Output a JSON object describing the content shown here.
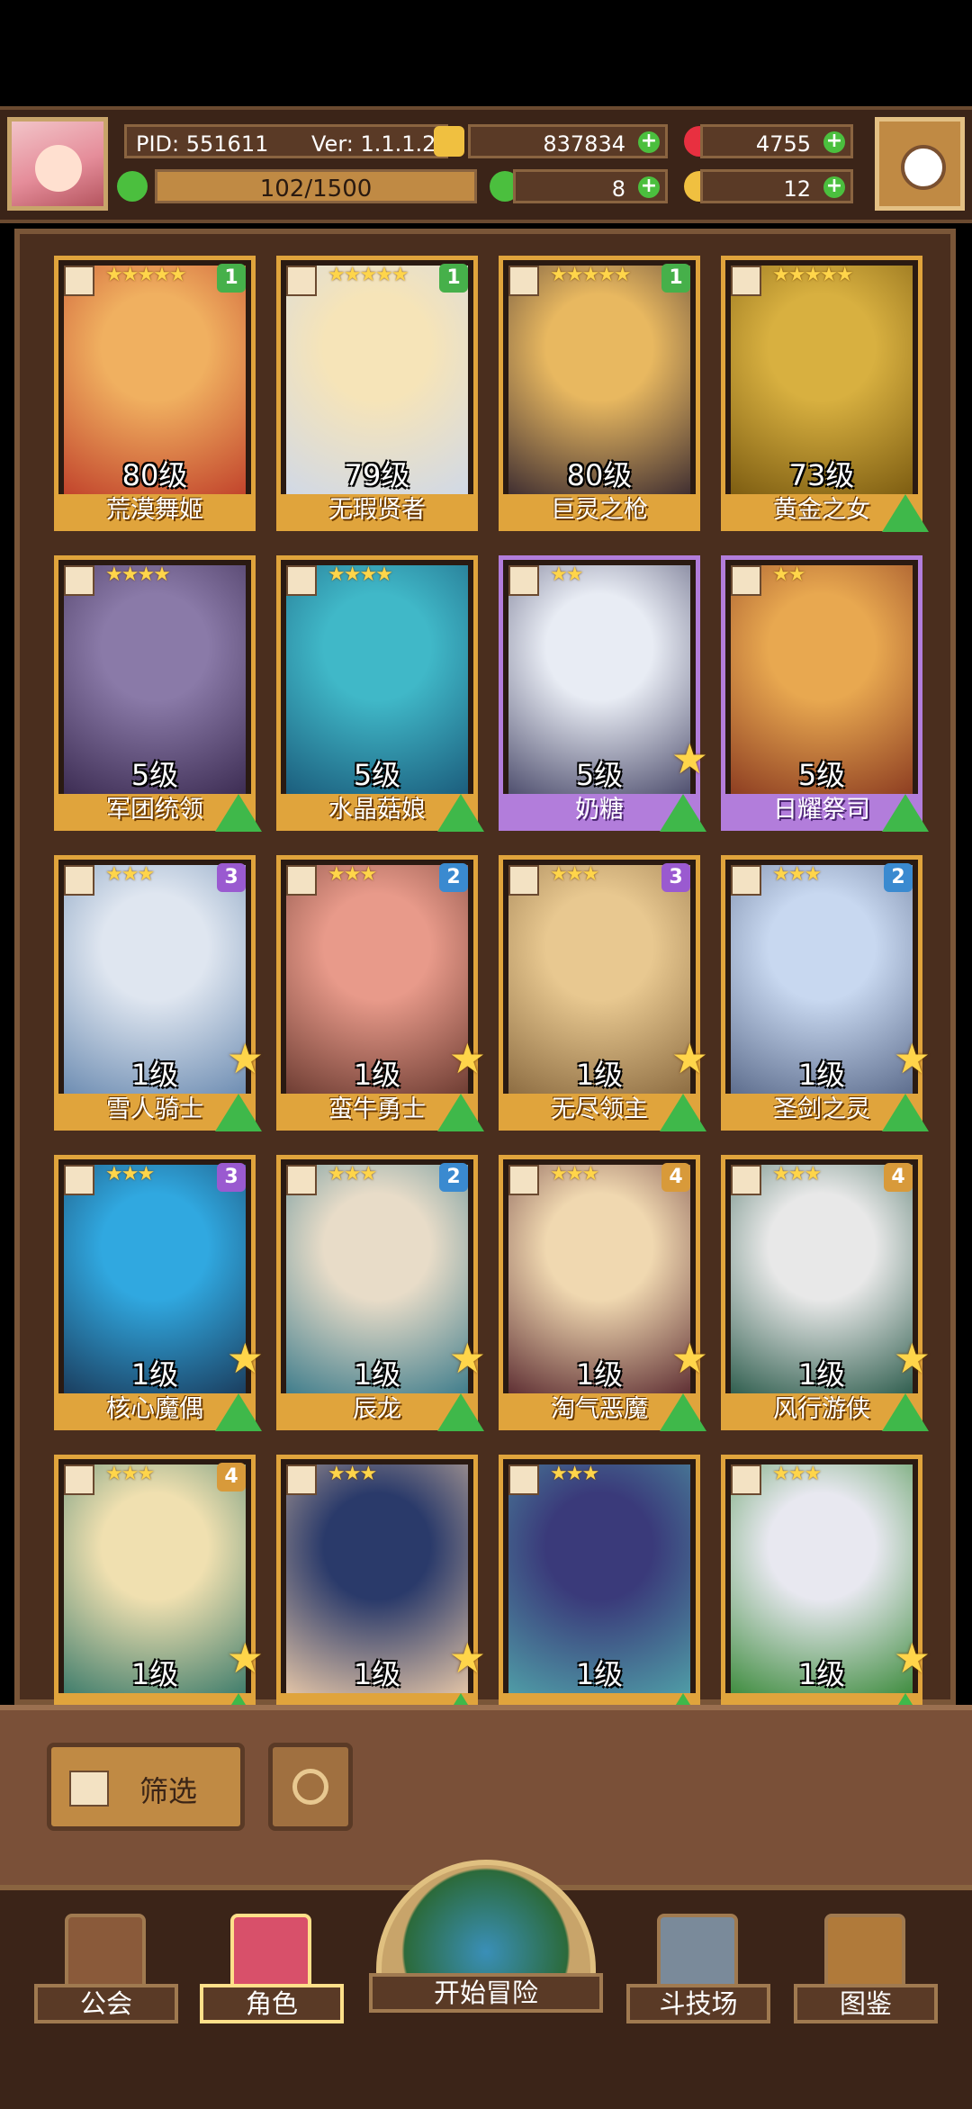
{
  "player": {
    "pid_label": "PID: 551611",
    "version": "Ver: 1.1.1.2",
    "gold": "837834",
    "gems": "4755",
    "energy": "102/1500",
    "clover": "8",
    "bread": "12"
  },
  "colors": {
    "frame_gold": "#e0a43c",
    "frame_purple": "#b27ddb",
    "plus_green": "#4bbf3e",
    "board_bg": "#4a2e1e"
  },
  "cards": [
    {
      "name": "荒漠舞姬",
      "level": "80级",
      "stars": "★★★★★",
      "badge": "1",
      "badge_color": "#46b04a",
      "frame": "gold",
      "art": [
        "#f0b060",
        "#c0402a"
      ],
      "upgrade": false,
      "star": false
    },
    {
      "name": "无瑕贤者",
      "level": "79级",
      "stars": "★★★★★",
      "badge": "1",
      "badge_color": "#46b04a",
      "frame": "gold",
      "art": [
        "#f6e4b8",
        "#cfd8e8"
      ],
      "upgrade": false,
      "star": false
    },
    {
      "name": "巨灵之枪",
      "level": "80级",
      "stars": "★★★★★",
      "badge": "1",
      "badge_color": "#46b04a",
      "frame": "gold",
      "art": [
        "#e8b860",
        "#3a2a30"
      ],
      "upgrade": false,
      "star": false
    },
    {
      "name": "黄金之女",
      "level": "73级",
      "stars": "★★★★★",
      "badge": "",
      "badge_color": "",
      "frame": "gold",
      "art": [
        "#d8b040",
        "#7a5a10"
      ],
      "upgrade": true,
      "star": false
    },
    {
      "name": "军团统领",
      "level": "5级",
      "stars": "★★★★",
      "badge": "",
      "badge_color": "",
      "frame": "gold",
      "art": [
        "#8a7aa8",
        "#3a2a50"
      ],
      "upgrade": true,
      "star": false
    },
    {
      "name": "水晶菇娘",
      "level": "5级",
      "stars": "★★★★",
      "badge": "",
      "badge_color": "",
      "frame": "gold",
      "art": [
        "#40b8c8",
        "#1a5a7a"
      ],
      "upgrade": true,
      "star": false
    },
    {
      "name": "奶糖",
      "level": "5级",
      "stars": "★★",
      "badge": "",
      "badge_color": "",
      "frame": "purple",
      "art": [
        "#e8ecf4",
        "#4a4a6a"
      ],
      "upgrade": true,
      "star": true
    },
    {
      "name": "日耀祭司",
      "level": "5级",
      "stars": "★★",
      "badge": "",
      "badge_color": "",
      "frame": "purple",
      "art": [
        "#e8a850",
        "#8a3a20"
      ],
      "upgrade": true,
      "star": false
    },
    {
      "name": "雪人骑士",
      "level": "1级",
      "stars": "★★★",
      "badge": "3",
      "badge_color": "#9a5ad0",
      "frame": "gold",
      "art": [
        "#dfe6f0",
        "#6a8ab0"
      ],
      "upgrade": true,
      "star": true
    },
    {
      "name": "蛮牛勇士",
      "level": "1级",
      "stars": "★★★",
      "badge": "2",
      "badge_color": "#3a8ad0",
      "frame": "gold",
      "art": [
        "#e89a8a",
        "#6a3a30"
      ],
      "upgrade": true,
      "star": true
    },
    {
      "name": "无尽领主",
      "level": "1级",
      "stars": "★★★",
      "badge": "3",
      "badge_color": "#9a5ad0",
      "frame": "gold",
      "art": [
        "#e8c890",
        "#8a6a40"
      ],
      "upgrade": true,
      "star": true
    },
    {
      "name": "圣剑之灵",
      "level": "1级",
      "stars": "★★★",
      "badge": "2",
      "badge_color": "#3a8ad0",
      "frame": "gold",
      "art": [
        "#c8d8f0",
        "#5a6a8a"
      ],
      "upgrade": true,
      "star": true
    },
    {
      "name": "核心魔偶",
      "level": "1级",
      "stars": "★★★",
      "badge": "3",
      "badge_color": "#9a5ad0",
      "frame": "gold",
      "art": [
        "#30a8e0",
        "#1a3a5a"
      ],
      "upgrade": true,
      "star": true
    },
    {
      "name": "辰龙",
      "level": "1级",
      "stars": "★★★",
      "badge": "2",
      "badge_color": "#3a8ad0",
      "frame": "gold",
      "art": [
        "#e8dcc8",
        "#3a7a8a"
      ],
      "upgrade": true,
      "star": true
    },
    {
      "name": "淘气恶魔",
      "level": "1级",
      "stars": "★★★",
      "badge": "4",
      "badge_color": "#d89a3a",
      "frame": "gold",
      "art": [
        "#f0d8b0",
        "#5a2a30"
      ],
      "upgrade": true,
      "star": true
    },
    {
      "name": "风行游侠",
      "level": "1级",
      "stars": "★★★",
      "badge": "4",
      "badge_color": "#d89a3a",
      "frame": "gold",
      "art": [
        "#e8e8e8",
        "#2a5a4a"
      ],
      "upgrade": true,
      "star": true
    },
    {
      "name": "",
      "level": "1级",
      "stars": "★★★",
      "badge": "4",
      "badge_color": "#d89a3a",
      "frame": "gold",
      "art": [
        "#f0e0b0",
        "#3a7a6a"
      ],
      "upgrade": true,
      "star": true
    },
    {
      "name": "",
      "level": "1级",
      "stars": "★★★",
      "badge": "",
      "badge_color": "",
      "frame": "gold",
      "art": [
        "#2a3a6a",
        "#e8c8a8"
      ],
      "upgrade": true,
      "star": true
    },
    {
      "name": "",
      "level": "1级",
      "stars": "★★★",
      "badge": "",
      "badge_color": "",
      "frame": "gold",
      "art": [
        "#3a3a7a",
        "#50a0a8"
      ],
      "upgrade": true,
      "star": false
    },
    {
      "name": "",
      "level": "1级",
      "stars": "★★★",
      "badge": "",
      "badge_color": "",
      "frame": "gold",
      "art": [
        "#e8e8f0",
        "#3a8a3a"
      ],
      "upgrade": true,
      "star": true
    }
  ],
  "controls": {
    "filter_label": "筛选"
  },
  "nav": {
    "guild": "公会",
    "character": "角色",
    "adventure": "开始冒险",
    "arena": "斗技场",
    "codex": "图鉴"
  }
}
